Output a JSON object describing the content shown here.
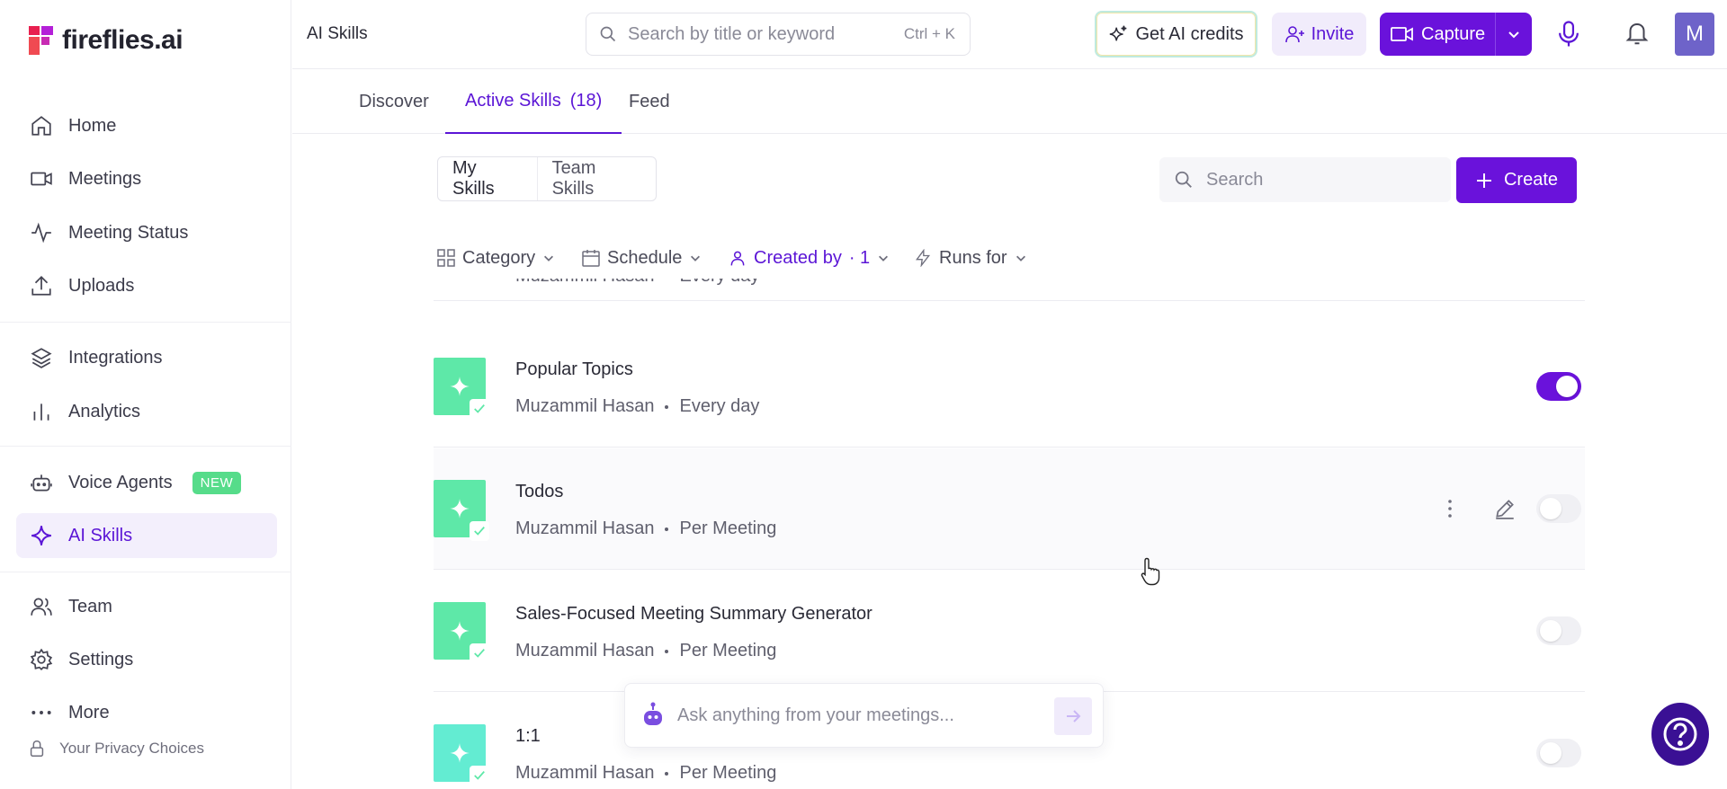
{
  "brand": {
    "name": "fireflies.ai"
  },
  "colors": {
    "accent": "#6a12db",
    "accent_text": "#5b15d6",
    "skill_icon": "#5ee8a8",
    "new_badge": "#56dc8a"
  },
  "sidebar": {
    "items": [
      {
        "label": "Home",
        "icon": "home-icon"
      },
      {
        "label": "Meetings",
        "icon": "video-icon"
      },
      {
        "label": "Meeting Status",
        "icon": "activity-icon"
      },
      {
        "label": "Uploads",
        "icon": "upload-icon"
      },
      {
        "label": "Integrations",
        "icon": "layers-icon"
      },
      {
        "label": "Analytics",
        "icon": "bar-chart-icon"
      },
      {
        "label": "Voice Agents",
        "icon": "robot-icon",
        "badge": "NEW"
      },
      {
        "label": "AI Skills",
        "icon": "sparkle-icon",
        "active": true
      },
      {
        "label": "Team",
        "icon": "users-icon"
      },
      {
        "label": "Settings",
        "icon": "gear-icon"
      },
      {
        "label": "More",
        "icon": "more-dots-icon"
      }
    ],
    "privacy": "Your Privacy Choices"
  },
  "topbar": {
    "title": "AI Skills",
    "search_placeholder": "Search by title or keyword",
    "shortcut": "Ctrl + K",
    "credits_label": "Get AI credits",
    "invite_label": "Invite",
    "capture_label": "Capture",
    "avatar_initial": "M"
  },
  "tabs": {
    "discover": "Discover",
    "active": "Active Skills",
    "active_count": "(18)",
    "feed": "Feed"
  },
  "toolbar": {
    "my_skills": "My Skills",
    "team_skills": "Team Skills",
    "search_placeholder": "Search",
    "create_label": "Create"
  },
  "filters": {
    "category": "Category",
    "schedule": "Schedule",
    "created_by": "Created by",
    "created_by_count": "· 1",
    "runs_for": "Runs for"
  },
  "skills": [
    {
      "title": "",
      "author": "Muzammil Hasan",
      "frequency": "Every day",
      "enabled": false
    },
    {
      "title": "Popular Topics",
      "author": "Muzammil Hasan",
      "frequency": "Every day",
      "enabled": true
    },
    {
      "title": "Todos",
      "author": "Muzammil Hasan",
      "frequency": "Per Meeting",
      "enabled": false
    },
    {
      "title": "Sales-Focused Meeting Summary Generator",
      "author": "Muzammil Hasan",
      "frequency": "Per Meeting",
      "enabled": false
    },
    {
      "title": "1:1",
      "author": "Muzammil Hasan",
      "frequency": "Per Meeting",
      "enabled": false
    }
  ],
  "ask": {
    "placeholder": "Ask anything from your meetings..."
  }
}
